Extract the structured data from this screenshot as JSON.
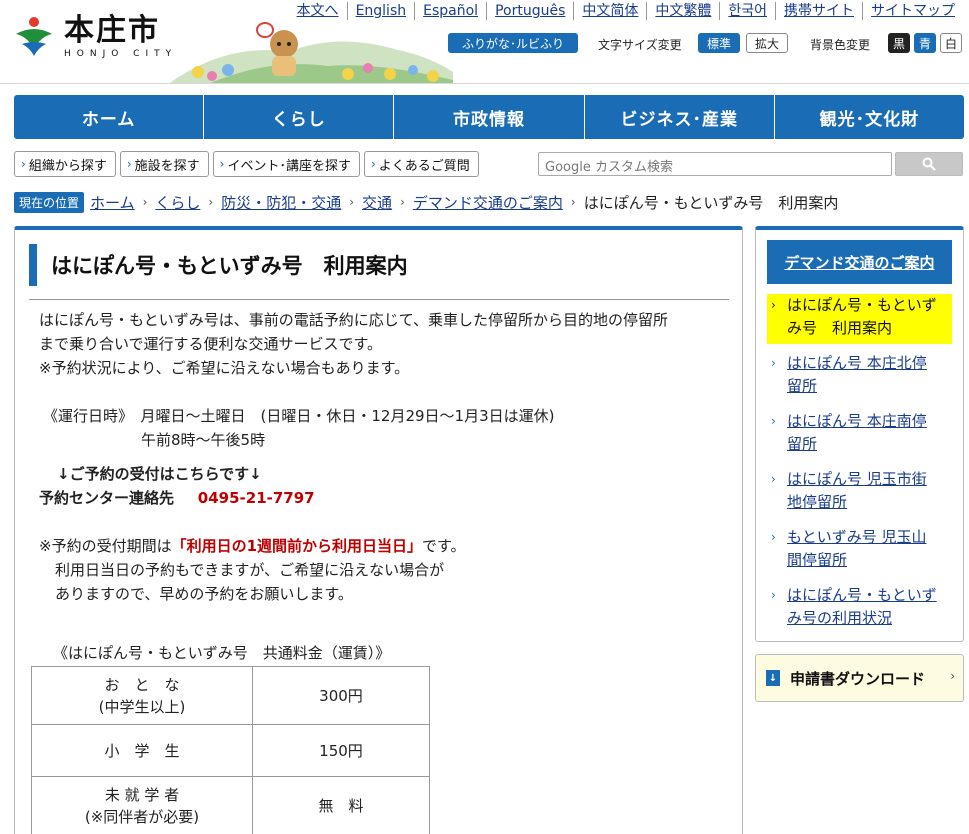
{
  "header": {
    "site_name": "本庄市",
    "site_name_en": "HONJO CITY",
    "lang_links": [
      "本文へ",
      "English",
      "Español",
      "Português",
      "中文简体",
      "中文繁體",
      "한국어",
      "携帯サイト",
      "サイトマップ"
    ],
    "ruby_button": "ふりがな･ルビふり",
    "font_size_label": "文字サイズ変更",
    "font_size_normal": "標準",
    "font_size_large": "拡大",
    "bg_color_label": "背景色変更",
    "bg_black": "黒",
    "bg_blue": "青",
    "bg_white": "白"
  },
  "global_nav": [
    "ホーム",
    "くらし",
    "市政情報",
    "ビジネス･産業",
    "観光･文化財"
  ],
  "sub_nav": [
    "組織から探す",
    "施設を探す",
    "イベント･講座を探す",
    "よくあるご質問"
  ],
  "search": {
    "placeholder": "Google カスタム検索"
  },
  "breadcrumb": {
    "label": "現在の位置",
    "links": [
      "ホーム",
      "くらし",
      "防災・防犯・交通",
      "交通",
      "デマンド交通のご案内"
    ],
    "current": "はにぽん号・もといずみ号　利用案内"
  },
  "main": {
    "title": "はにぽん号・もといずみ号　利用案内",
    "intro_1": "はにぽん号・もといずみ号は、事前の電話予約に応じて、乗車した停留所から目的地の停留所",
    "intro_2": "まで乗り合いで運行する便利な交通サービスです。",
    "intro_3": "※予約状況により、ご希望に沿えない場合もあります。",
    "schedule_1": "《運行日時》　月曜日～土曜日　(日曜日・休日・12月29日～1月3日は運休)",
    "schedule_2": "午前8時～午後5時",
    "reserve_heading": "↓ご予約の受付はこちらです↓",
    "reserve_label": "予約センター連絡先",
    "reserve_phone": "0495-21-7797",
    "period_prefix": "※予約の受付期間は",
    "period_highlight": "「利用日の1週間前から利用日当日」",
    "period_suffix": "です。",
    "period_note_1": "利用日当日の予約もできますが、ご希望に沿えない場合が",
    "period_note_2": "ありますので、早めの予約をお願いします。",
    "fare_caption": "《はにぽん号・もといずみ号　共通料金（運賃）》",
    "fares": [
      {
        "category": "お　と　な",
        "note": "(中学生以上)",
        "price": "300円"
      },
      {
        "category": "小　学　生",
        "note": "",
        "price": "150円"
      },
      {
        "category": "未 就 学 者",
        "note": "(※同伴者が必要)",
        "price": "無　料"
      }
    ]
  },
  "sidebar": {
    "heading": "デマンド交通のご案内",
    "items": [
      {
        "line1": "はにぽん号・もといず",
        "line2": "み号　利用案内"
      },
      {
        "line1": "はにぽん号 本庄北停",
        "line2": "留所"
      },
      {
        "line1": "はにぽん号 本庄南停",
        "line2": "留所"
      },
      {
        "line1": "はにぽん号 児玉市街",
        "line2": "地停留所"
      },
      {
        "line1": "もといずみ号 児玉山",
        "line2": "間停留所"
      },
      {
        "line1": "はにぽん号・もといず",
        "line2": "み号の利用状況"
      }
    ],
    "download": "申請書ダウンロード"
  },
  "colors": {
    "primary": "#1a6db5",
    "highlight": "#ffff00",
    "alert": "#c00000"
  }
}
